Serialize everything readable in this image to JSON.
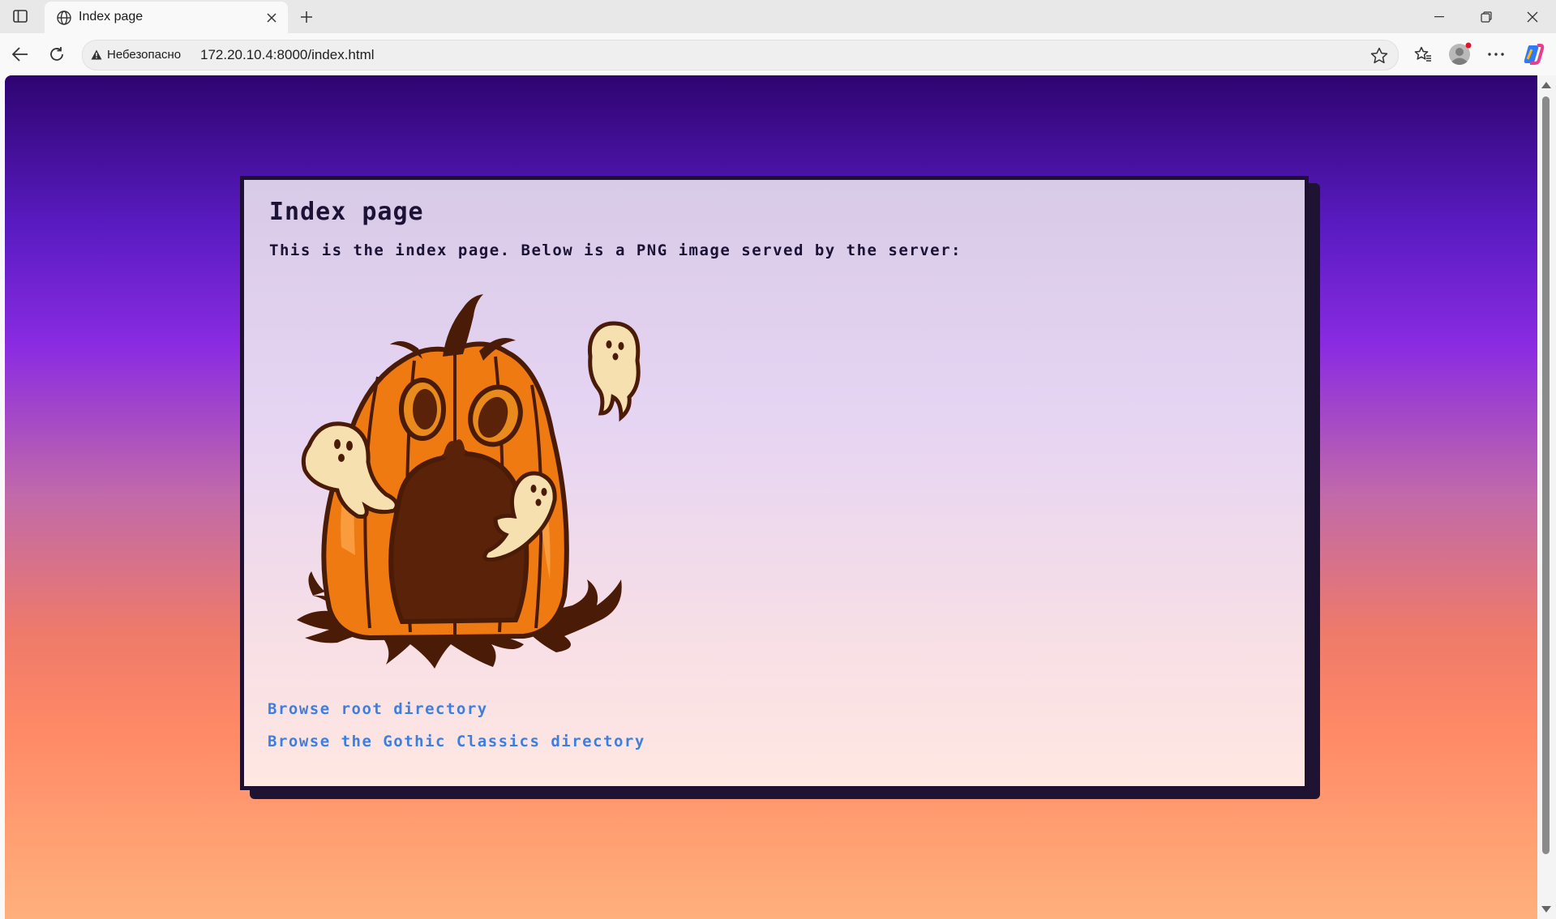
{
  "browser": {
    "tab": {
      "title": "Index page",
      "favicon": "globe-icon"
    },
    "address_bar": {
      "security_label": "Небезопасно",
      "url": "172.20.10.4:8000/index.html"
    }
  },
  "page": {
    "title": "Index page",
    "description": "This is the index page. Below is a PNG image served by the server:",
    "image": {
      "subject": "pumpkin-with-ghosts"
    },
    "links": [
      {
        "label": "Browse root directory"
      },
      {
        "label": "Browse the Gothic Classics directory"
      }
    ]
  },
  "colors": {
    "link": "#3d7fe0",
    "card_border": "#1d1030",
    "bg_top": "#2e0470",
    "bg_bottom": "#ffb07c"
  }
}
